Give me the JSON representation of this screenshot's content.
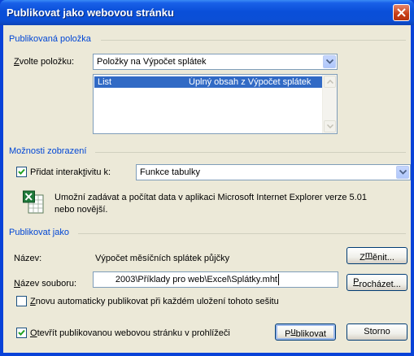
{
  "window": {
    "title": "Publikovat jako webovou stránku"
  },
  "group_published": {
    "label": "Publikovaná položka",
    "choose_label_prefix": "Z",
    "choose_label_rest": "volte položku:",
    "choose_value": "Položky na Výpočet splátek",
    "list": [
      {
        "name": "List",
        "description": "Úplný obsah z Výpočet splátek"
      }
    ]
  },
  "group_display": {
    "label": "Možnosti zobrazení",
    "add_interactivity_pre": "Přidat interak",
    "add_interactivity_key": "t",
    "add_interactivity_post": "ivitu k:",
    "add_interactivity_checked": true,
    "interactivity_value": "Funkce tabulky",
    "description_line1": "Umožní zadávat a počítat data v aplikaci Microsoft Internet Explorer verze 5.01",
    "description_line2": "nebo novější."
  },
  "group_publish_as": {
    "label": "Publikovat jako",
    "name_label": "Název:",
    "name_value": "Výpočet měsíčních splátek půjčky",
    "change_button_pre": "Z",
    "change_button_key": "m",
    "change_button_post": "ěnit...",
    "filename_label_key": "N",
    "filename_label_rest": "ázev souboru:",
    "filename_value": "2003\\Příklady pro web\\Excel\\Splátky.mht",
    "browse_button_key": "P",
    "browse_button_rest": "rocházet...",
    "auto_republish_key": "Z",
    "auto_republish_rest": "novu automaticky publikovat při každém uložení tohoto sešitu",
    "auto_republish_checked": false
  },
  "footer": {
    "open_in_browser_key": "O",
    "open_in_browser_rest": "tevřít publikovanou webovou stránku v prohlížeči",
    "open_in_browser_checked": true,
    "publish_pre": "P",
    "publish_key": "u",
    "publish_post": "blikovat",
    "cancel_label": "Storno"
  },
  "colors": {
    "title_bar": "#0a4fd9",
    "dialog_bg": "#ece9d8",
    "group_label": "#0046d5",
    "selection": "#316ac5"
  }
}
